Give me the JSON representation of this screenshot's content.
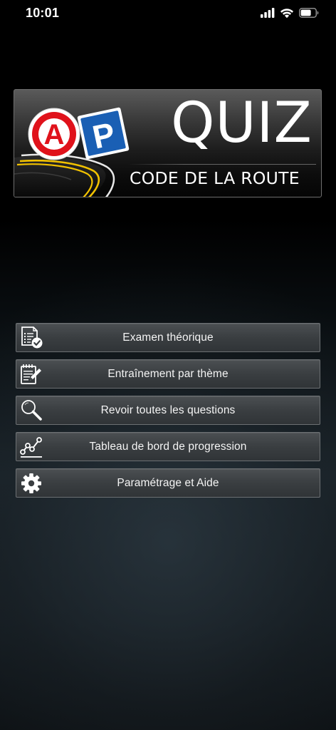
{
  "status_bar": {
    "time": "10:01"
  },
  "logo": {
    "badge_a": "A",
    "badge_p": "P",
    "title": "QUIZ",
    "subtitle": "CODE DE LA ROUTE"
  },
  "menu": {
    "items": [
      {
        "label": "Examen théorique",
        "icon": "exam-checklist-icon"
      },
      {
        "label": "Entraînement par thème",
        "icon": "notepad-pencil-icon"
      },
      {
        "label": "Revoir toutes les questions",
        "icon": "magnifier-icon"
      },
      {
        "label": "Tableau de bord de progression",
        "icon": "line-chart-icon"
      },
      {
        "label": "Paramétrage et Aide",
        "icon": "gear-icon"
      }
    ]
  },
  "colors": {
    "badge_a_red": "#e0121b",
    "badge_p_blue": "#1a5fb4",
    "road_yellow": "#f2c200"
  }
}
